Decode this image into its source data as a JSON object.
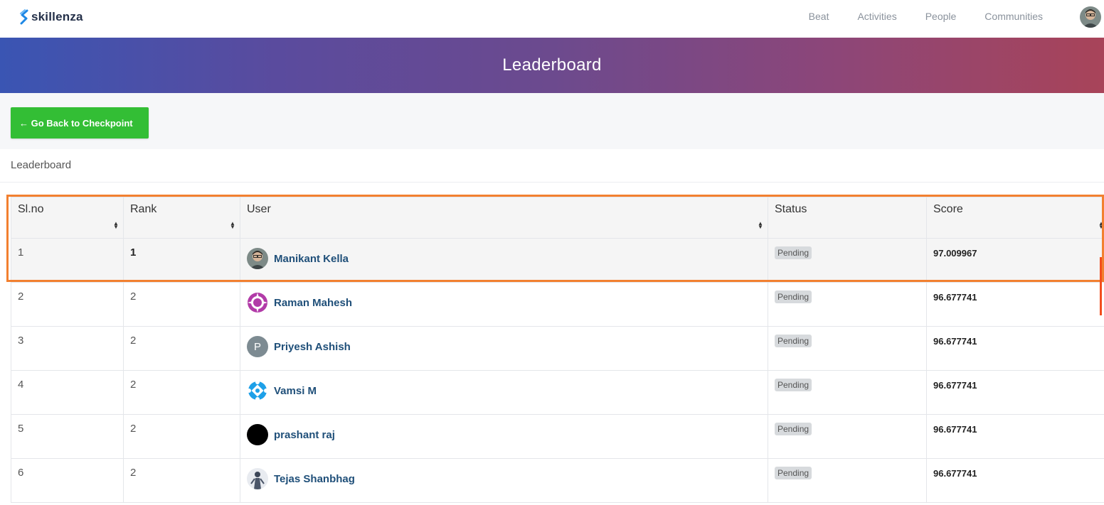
{
  "brand": {
    "name": "skillenza",
    "brand_color": "#243049",
    "logo_color": "#1e88e5"
  },
  "nav": {
    "links": [
      "Beat",
      "Activities",
      "People",
      "Communities"
    ]
  },
  "hero": {
    "title": "Leaderboard"
  },
  "back_button": {
    "label": "← Go Back to Checkpoint",
    "color": "#33be35"
  },
  "section_label": "Leaderboard",
  "table": {
    "columns": [
      "Sl.no",
      "Rank",
      "User",
      "Status",
      "Score"
    ],
    "rows": [
      {
        "slno": "1",
        "rank": "1",
        "user": "Manikant Kella",
        "status": "Pending",
        "score": "97.009967"
      },
      {
        "slno": "2",
        "rank": "2",
        "user": "Raman Mahesh",
        "status": "Pending",
        "score": "96.677741"
      },
      {
        "slno": "3",
        "rank": "2",
        "user": "Priyesh Ashish",
        "status": "Pending",
        "score": "96.677741"
      },
      {
        "slno": "4",
        "rank": "2",
        "user": "Vamsi M",
        "status": "Pending",
        "score": "96.677741"
      },
      {
        "slno": "5",
        "rank": "2",
        "user": "prashant raj",
        "status": "Pending",
        "score": "96.677741"
      },
      {
        "slno": "6",
        "rank": "2",
        "user": "Tejas Shanbhag",
        "status": "Pending",
        "score": "96.677741"
      }
    ],
    "avatar_letters": {
      "priyesh": "P"
    }
  },
  "colors": {
    "highlight": "#f28030",
    "link": "#1f4f79"
  },
  "icons": {
    "brand": "skillenza-s-logo",
    "sort": "sort-up-down-icon"
  }
}
